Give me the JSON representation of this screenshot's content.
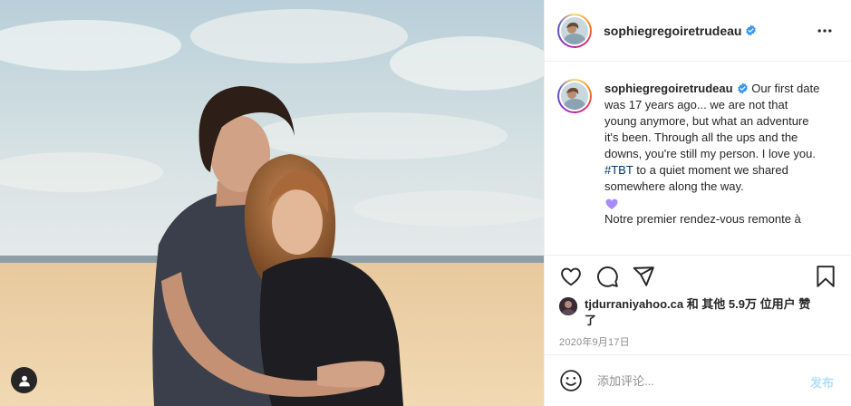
{
  "post": {
    "username": "sophiegregoiretrudeau",
    "verified": true,
    "caption": {
      "username": "sophiegregoiretrudeau",
      "text_before_tag": "Our first date was 17 years ago... we are not that young anymore, but what an adventure it's been. Through all the ups and the downs, you're still my person. I love you.",
      "hashtag": "#TBT",
      "text_after_tag": "to a quiet moment we shared somewhere along the way.",
      "emoji": "purple-heart",
      "second_paragraph": "Notre premier rendez-vous remonte à"
    },
    "likes": {
      "text": "tjdurraniyahoo.ca 和 其他 5.9万 位用户 赞了"
    },
    "date": "2020年9月17日",
    "comment": {
      "placeholder": "添加评论...",
      "post_label": "发布"
    },
    "icons": [
      "heart-icon",
      "comment-icon",
      "share-icon",
      "bookmark-icon",
      "more-icon",
      "emoji-icon",
      "user-tag-icon",
      "verified-icon"
    ],
    "colors": {
      "hashtag": "#00376b",
      "verified": "#3897f0",
      "post_button": "#b2dffc",
      "heart_emoji": "#a78bfa"
    }
  }
}
